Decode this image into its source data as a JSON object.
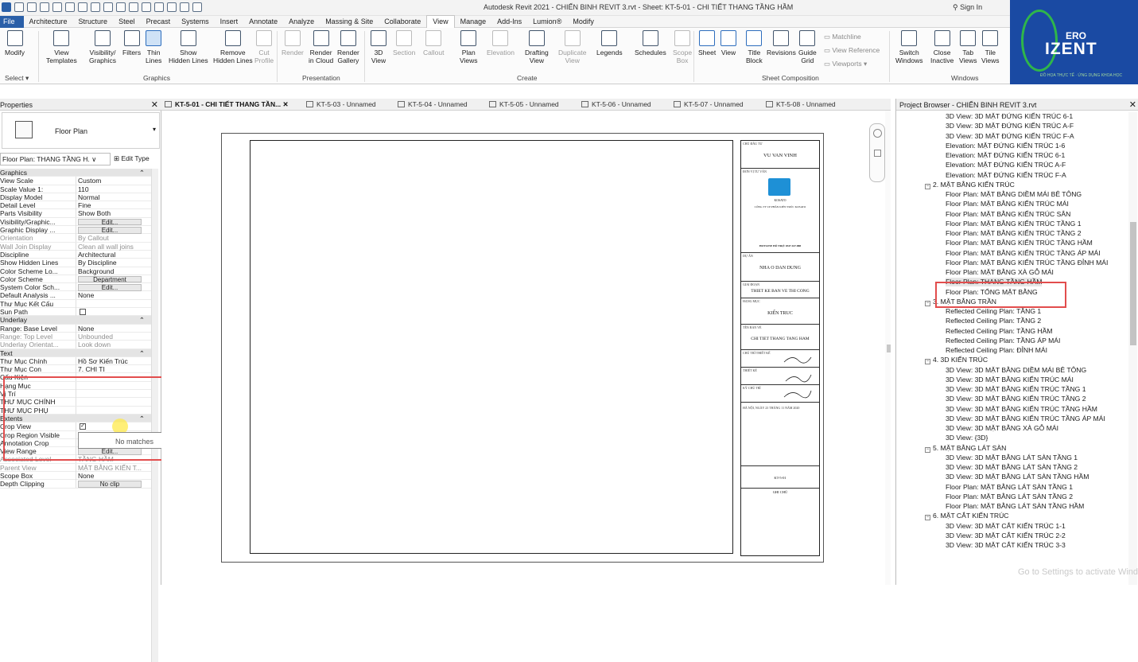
{
  "app": {
    "title": "Autodesk Revit 2021 - CHIẾN BINH REVIT 3.rvt - Sheet: KT-5-01 - CHI TIẾT THANG TẦNG HẦM",
    "sign_in": "Sign In"
  },
  "menu": [
    "File",
    "Architecture",
    "Structure",
    "Steel",
    "Precast",
    "Systems",
    "Insert",
    "Annotate",
    "Analyze",
    "Massing & Site",
    "Collaborate",
    "View",
    "Manage",
    "Add-Ins",
    "Lumion®",
    "Modify"
  ],
  "menu_active": "View",
  "ribbon": {
    "buttons": [
      {
        "label": "Modify",
        "sub": ""
      },
      {
        "label": "View",
        "sub": "Templates"
      },
      {
        "label": "Visibility/",
        "sub": "Graphics"
      },
      {
        "label": "Filters",
        "sub": ""
      },
      {
        "label": "Thin",
        "sub": "Lines"
      },
      {
        "label": "Show",
        "sub": "Hidden Lines"
      },
      {
        "label": "Remove",
        "sub": "Hidden Lines"
      },
      {
        "label": "Cut",
        "sub": "Profile"
      },
      {
        "label": "Render",
        "sub": ""
      },
      {
        "label": "Render",
        "sub": "in Cloud"
      },
      {
        "label": "Render",
        "sub": "Gallery"
      },
      {
        "label": "3D",
        "sub": "View"
      },
      {
        "label": "Section",
        "sub": ""
      },
      {
        "label": "Callout",
        "sub": ""
      },
      {
        "label": "Plan",
        "sub": "Views"
      },
      {
        "label": "Elevation",
        "sub": ""
      },
      {
        "label": "Drafting",
        "sub": "View"
      },
      {
        "label": "Duplicate",
        "sub": "View"
      },
      {
        "label": "Legends",
        "sub": ""
      },
      {
        "label": "Schedules",
        "sub": ""
      },
      {
        "label": "Scope",
        "sub": "Box"
      },
      {
        "label": "Sheet",
        "sub": ""
      },
      {
        "label": "View",
        "sub": ""
      },
      {
        "label": "Title",
        "sub": "Block"
      },
      {
        "label": "Revisions",
        "sub": ""
      },
      {
        "label": "Guide",
        "sub": "Grid"
      },
      {
        "label": "Switch",
        "sub": "Windows"
      },
      {
        "label": "Close",
        "sub": "Inactive"
      },
      {
        "label": "Tab",
        "sub": "Views"
      },
      {
        "label": "Tile",
        "sub": "Views"
      }
    ],
    "select": "Select",
    "small_items": [
      "Matchline",
      "View Reference",
      "Viewports"
    ],
    "groups": [
      "Graphics",
      "Presentation",
      "Create",
      "Sheet Composition",
      "Windows"
    ]
  },
  "logo": {
    "ero": "ERO",
    "izent": "IZENT",
    "tagline": "ĐỒ HỌA THỰC TẾ · ỨNG DỤNG KHOA HỌC"
  },
  "properties": {
    "title": "Properties",
    "type_name": "Floor Plan",
    "instance_selector": "Floor Plan: THANG TẦNG H.",
    "edit_type": "Edit Type",
    "rows": [
      {
        "kind": "hdr",
        "k": "Graphics"
      },
      {
        "k": "View Scale",
        "v": "Custom"
      },
      {
        "k": "Scale Value 1:",
        "v": "110"
      },
      {
        "k": "Display Model",
        "v": "Normal"
      },
      {
        "k": "Detail Level",
        "v": "Fine"
      },
      {
        "k": "Parts Visibility",
        "v": "Show Both"
      },
      {
        "k": "Visibility/Graphic...",
        "btn": "Edit..."
      },
      {
        "k": "Graphic Display ...",
        "btn": "Edit..."
      },
      {
        "k": "Orientation",
        "v": "By Callout",
        "grey": true
      },
      {
        "k": "Wall Join Display",
        "v": "Clean all wall joins",
        "grey": true
      },
      {
        "k": "Discipline",
        "v": "Architectural"
      },
      {
        "k": "Show Hidden Lines",
        "v": "By Discipline"
      },
      {
        "k": "Color Scheme Lo...",
        "v": "Background"
      },
      {
        "k": "Color Scheme",
        "btn": "Department"
      },
      {
        "k": "System Color Sch...",
        "btn": "Edit..."
      },
      {
        "k": "Default Analysis ...",
        "v": "None"
      },
      {
        "k": "Thư Mục Kết Cấu",
        "v": ""
      },
      {
        "k": "Sun Path",
        "chk": ""
      },
      {
        "kind": "hdr",
        "k": "Underlay"
      },
      {
        "k": "Range: Base Level",
        "v": "None"
      },
      {
        "k": "Range: Top Level",
        "v": "Unbounded",
        "grey": true
      },
      {
        "k": "Underlay Orientat...",
        "v": "Look down",
        "grey": true
      },
      {
        "kind": "hdr",
        "k": "Text"
      },
      {
        "k": "Thư Mục Chính",
        "v": "Hồ Sơ Kiến Trúc"
      },
      {
        "k": "Thư Mục Con",
        "v": "7. CHI TI"
      },
      {
        "k": "Cấu Kiện",
        "v": ""
      },
      {
        "k": "Hạng Mục",
        "v": ""
      },
      {
        "k": "Vị Trí",
        "v": ""
      },
      {
        "k": "THƯ MỤC CHÍNH",
        "v": ""
      },
      {
        "k": "THƯ MỤC PHỤ",
        "v": ""
      },
      {
        "kind": "hdr",
        "k": "Extents"
      },
      {
        "k": "Crop View",
        "chk": "✓"
      },
      {
        "k": "Crop Region Visible",
        "chk": "✓"
      },
      {
        "k": "Annotation Crop",
        "chk": "✓"
      },
      {
        "k": "View Range",
        "btn": "Edit..."
      },
      {
        "k": "Associated Level",
        "v": "TẦNG HẦM",
        "grey": true
      },
      {
        "k": "Parent View",
        "v": "MẶT BẰNG KIẾN T...",
        "grey": true
      },
      {
        "k": "Scope Box",
        "v": "None"
      },
      {
        "k": "Depth Clipping",
        "btn": "No clip"
      }
    ],
    "dropdown_text": "No matches"
  },
  "tabs": [
    {
      "label": "KT-5-01 - CHI TIẾT THANG TẦN...",
      "active": true
    },
    {
      "label": "KT-5-03 - Unnamed"
    },
    {
      "label": "KT-5-04 - Unnamed"
    },
    {
      "label": "KT-5-05 - Unnamed"
    },
    {
      "label": "KT-5-06 - Unnamed"
    },
    {
      "label": "KT-5-07 - Unnamed"
    },
    {
      "label": "KT-5-08 - Unnamed"
    }
  ],
  "titleblock": {
    "chu_dau_tu_caption": "CHỦ ĐẦU TƯ",
    "owner": "VU VAN VINH",
    "don_vi_caption": "ĐƠN VỊ TƯ VẤN",
    "company": "CÔNG TY CP PHẦN KIẾN TRÚC KOSATO",
    "kosato": "KOSATO",
    "hotline": "HOTLINE HỖ TRỢ: 0347.167.888",
    "du_an_caption": "DỰ ÁN",
    "project": "NHA O DAN DUNG",
    "giai_doan_caption": "GIAI ĐOẠN",
    "stage": "THIET KE BAN VE THI CONG",
    "hang_muc_caption": "HẠNG MỤC",
    "category": "KIẾN TRUC",
    "ten_ban_ve_caption": "TÊN BẢN VẼ",
    "drawing_name": "CHI TIET THANG TANG HAM",
    "role1": "CHỦ TRÌ THIẾT KẾ",
    "role2": "THIẾT KẾ",
    "role3": "KỸ CHỦ TRÌ",
    "date_line": "HÀ NỘI, NGÀY 23 THÁNG 11 NĂM 2020",
    "sheet_no": "KT-5-01",
    "ghi_chu": "GHI CHÚ"
  },
  "browser": {
    "title": "Project Browser - CHIẾN BINH REVIT 3.rvt",
    "items": [
      {
        "t": "3D View: 3D MẶT ĐỨNG KIẾN TRÚC 6-1",
        "lvl": 2
      },
      {
        "t": "3D View: 3D MẶT ĐỨNG KIẾN TRÚC A-F",
        "lvl": 2
      },
      {
        "t": "3D View: 3D MẶT ĐỨNG KIẾN TRÚC F-A",
        "lvl": 2
      },
      {
        "t": "Elevation: MẶT ĐỨNG KIẾN TRÚC 1-6",
        "lvl": 2
      },
      {
        "t": "Elevation: MẶT ĐỨNG KIẾN TRÚC 6-1",
        "lvl": 2
      },
      {
        "t": "Elevation: MẶT ĐỨNG KIẾN TRÚC A-F",
        "lvl": 2
      },
      {
        "t": "Elevation: MẶT ĐỨNG KIẾN TRÚC F-A",
        "lvl": 2
      },
      {
        "t": "2. MẶT BẰNG KIẾN TRÚC",
        "lvl": 1
      },
      {
        "t": "Floor Plan: MẶT BẰNG DIỀM MÁI BÊ TÔNG",
        "lvl": 2
      },
      {
        "t": "Floor Plan: MẶT BẰNG KIẾN TRÚC MÁI",
        "lvl": 2
      },
      {
        "t": "Floor Plan: MẶT BẰNG KIẾN TRÚC SÂN",
        "lvl": 2
      },
      {
        "t": "Floor Plan: MẶT BẰNG KIẾN TRÚC TẦNG 1",
        "lvl": 2
      },
      {
        "t": "Floor Plan: MẶT BẰNG KIẾN TRÚC TẦNG 2",
        "lvl": 2
      },
      {
        "t": "Floor Plan: MẶT BẰNG KIẾN TRÚC TẦNG HẦM",
        "lvl": 2
      },
      {
        "t": "Floor Plan: MẶT BẰNG KIẾN TRÚC TẦNG ÁP MÁI",
        "lvl": 2
      },
      {
        "t": "Floor Plan: MẶT BẰNG KIẾN TRÚC TẦNG ĐỈNH MÁI",
        "lvl": 2
      },
      {
        "t": "Floor Plan: MẶT BẰNG XÀ GỖ MÁI",
        "lvl": 2
      },
      {
        "t": "Floor Plan: THANG TẦNG HẦM",
        "lvl": 2,
        "sel": true
      },
      {
        "t": "Floor Plan: TỔNG MẶT BẰNG",
        "lvl": 2
      },
      {
        "t": "3. MẶT BẰNG TRẦN",
        "lvl": 1
      },
      {
        "t": "Reflected Ceiling Plan: TẦNG 1",
        "lvl": 2
      },
      {
        "t": "Reflected Ceiling Plan: TẦNG 2",
        "lvl": 2
      },
      {
        "t": "Reflected Ceiling Plan: TẦNG HẦM",
        "lvl": 2
      },
      {
        "t": "Reflected Ceiling Plan: TẦNG ÁP MÁI",
        "lvl": 2
      },
      {
        "t": "Reflected Ceiling Plan: ĐỈNH MÁI",
        "lvl": 2
      },
      {
        "t": "4. 3D KIẾN TRÚC",
        "lvl": 1
      },
      {
        "t": "3D View: 3D MẶT BẰNG DIỀM MÁI BÊ TÔNG",
        "lvl": 2
      },
      {
        "t": "3D View: 3D MẶT BẰNG KIẾN TRÚC MÁI",
        "lvl": 2
      },
      {
        "t": "3D View: 3D MẶT BẰNG KIẾN TRÚC TẦNG 1",
        "lvl": 2
      },
      {
        "t": "3D View: 3D MẶT BẰNG KIẾN TRÚC TẦNG 2",
        "lvl": 2
      },
      {
        "t": "3D View: 3D MẶT BẰNG KIẾN TRÚC TẦNG HẦM",
        "lvl": 2
      },
      {
        "t": "3D View: 3D MẶT BẰNG KIẾN TRÚC TẦNG ÁP MÁI",
        "lvl": 2
      },
      {
        "t": "3D View: 3D MẶT BẰNG XÀ GỖ MÁI",
        "lvl": 2
      },
      {
        "t": "3D View: {3D}",
        "lvl": 2
      },
      {
        "t": "5. MẶT BẰNG LÁT SÀN",
        "lvl": 1
      },
      {
        "t": "3D View: 3D MẶT BẰNG LÁT SÀN TẦNG 1",
        "lvl": 2
      },
      {
        "t": "3D View: 3D MẶT BẰNG LÁT SÀN TẦNG 2",
        "lvl": 2
      },
      {
        "t": "3D View: 3D MẶT BẰNG LÁT SÀN TẦNG HẦM",
        "lvl": 2
      },
      {
        "t": "Floor Plan: MẶT BẰNG LÁT SÀN TẦNG 1",
        "lvl": 2
      },
      {
        "t": "Floor Plan: MẶT BẰNG LÁT SÀN TẦNG 2",
        "lvl": 2
      },
      {
        "t": "Floor Plan: MẶT BẰNG LÁT SÀN TẦNG HẦM",
        "lvl": 2
      },
      {
        "t": "6. MẶT CẮT KIẾN TRÚC",
        "lvl": 1
      },
      {
        "t": "3D View: 3D MẶT CẮT KIẾN TRÚC 1-1",
        "lvl": 2
      },
      {
        "t": "3D View: 3D MẶT CẮT KIẾN TRÚC 2-2",
        "lvl": 2
      },
      {
        "t": "3D View: 3D MẶT CẮT KIẾN TRÚC 3-3",
        "lvl": 2
      }
    ]
  },
  "watermark": "Go to Settings to activate Windows."
}
